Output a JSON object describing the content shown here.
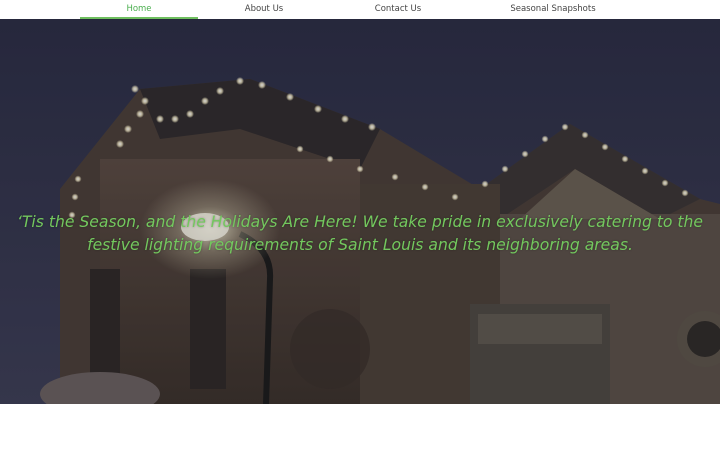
{
  "nav": {
    "items": [
      {
        "label": "Home",
        "active": true
      },
      {
        "label": "About Us",
        "active": false
      },
      {
        "label": "Contact Us",
        "active": false
      },
      {
        "label": "Seasonal Snapshots",
        "active": false
      }
    ],
    "active_color": "#4caf50",
    "underline_color": "#6fbf5f"
  },
  "hero": {
    "headline_line1": "‘Tis the Season, and the Holidays Are Here! We take pride in exclusively catering to the",
    "headline_line2": "festive lighting requirements of Saint Louis and its neighboring areas.",
    "text_color": "#73c85e",
    "image_subject": "house-with-christmas-roofline-lights"
  }
}
